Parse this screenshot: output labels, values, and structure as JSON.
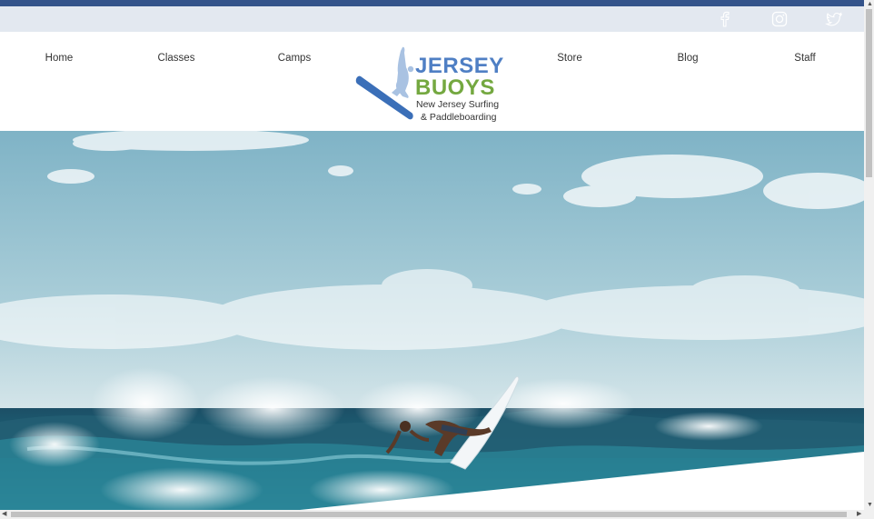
{
  "nav": {
    "items": [
      {
        "label": "Home"
      },
      {
        "label": "Classes"
      },
      {
        "label": "Camps"
      },
      {
        "label": "Store"
      },
      {
        "label": "Blog"
      },
      {
        "label": "Staff"
      }
    ]
  },
  "logo": {
    "line1": "JERSEY",
    "line2": "BUOYS",
    "line3": "New Jersey Surfing",
    "line4": "& Paddleboarding"
  },
  "social": {
    "icons": [
      "facebook-icon",
      "instagram-icon",
      "twitter-icon"
    ]
  },
  "colors": {
    "top_bar": "#34538a",
    "social_bar": "#e3e8f0",
    "logo_blue": "#4f7fc4",
    "logo_green": "#74a840"
  }
}
